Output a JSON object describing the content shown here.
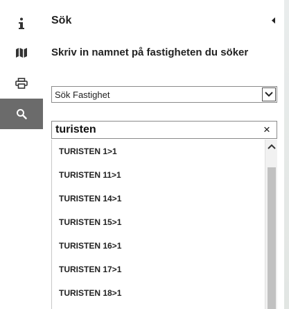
{
  "sidebar": {
    "items": [
      {
        "icon": "info-icon",
        "active": false
      },
      {
        "icon": "map-icon",
        "active": false
      },
      {
        "icon": "print-icon",
        "active": false
      },
      {
        "icon": "search-icon",
        "active": true
      }
    ],
    "active_color": "#6b6b6b"
  },
  "panel": {
    "title": "Sök",
    "instruction": "Skriv in namnet på fastigheten du söker"
  },
  "search_type": {
    "selected": "Sök Fastighet"
  },
  "search": {
    "value": "turisten",
    "clear_label": "×"
  },
  "results": [
    {
      "label": "TURISTEN 1>1"
    },
    {
      "label": "TURISTEN 11>1"
    },
    {
      "label": "TURISTEN 14>1"
    },
    {
      "label": "TURISTEN 15>1"
    },
    {
      "label": "TURISTEN 16>1"
    },
    {
      "label": "TURISTEN 17>1"
    },
    {
      "label": "TURISTEN 18>1"
    }
  ]
}
